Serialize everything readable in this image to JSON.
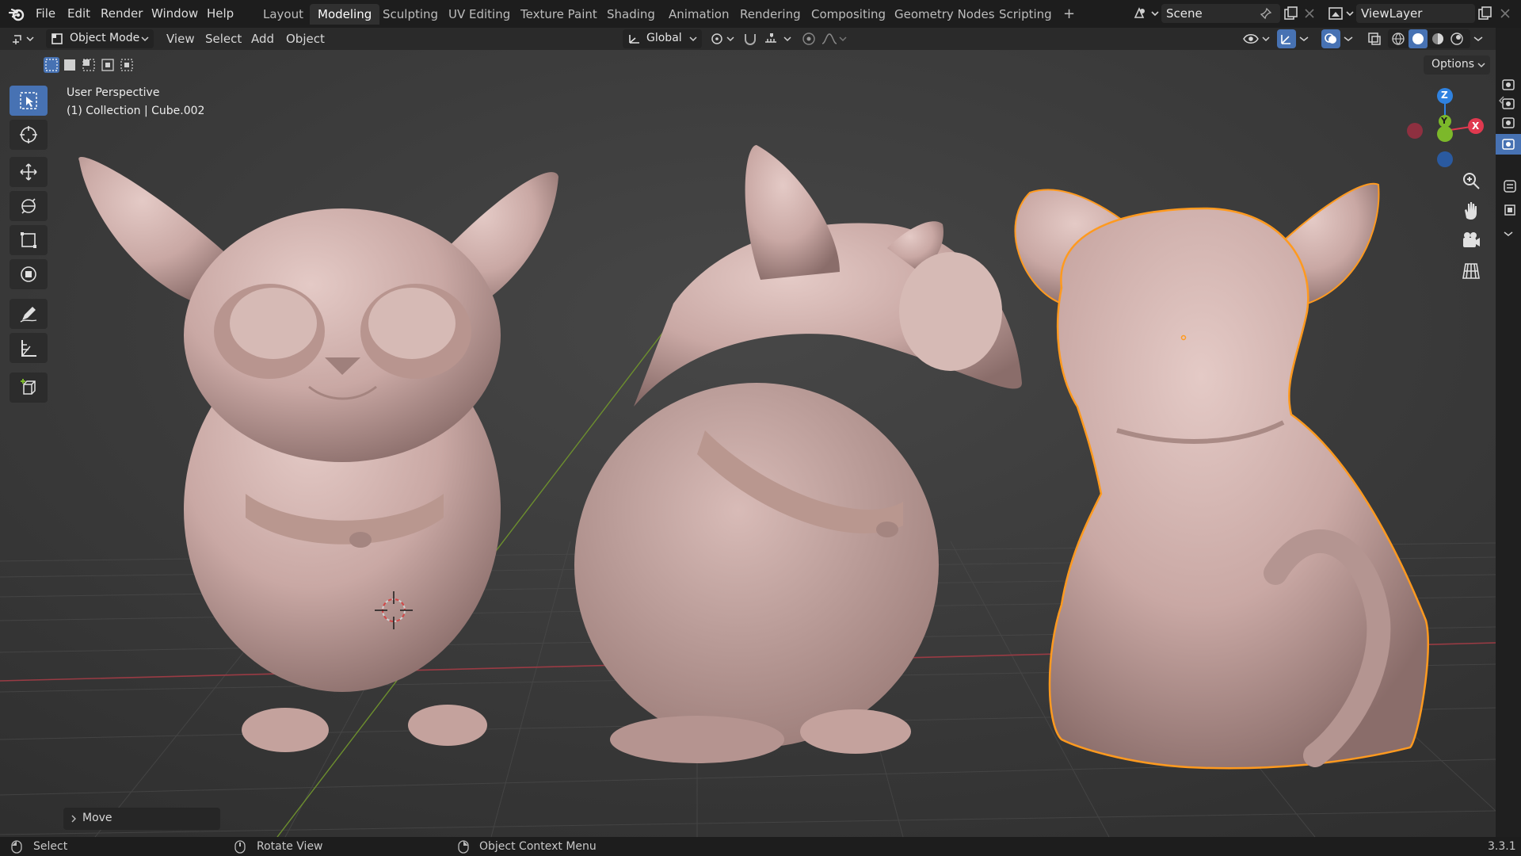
{
  "topbar": {
    "menus": [
      "File",
      "Edit",
      "Render",
      "Window",
      "Help"
    ],
    "workspaces": [
      "Layout",
      "Modeling",
      "Sculpting",
      "UV Editing",
      "Texture Paint",
      "Shading",
      "Animation",
      "Rendering",
      "Compositing",
      "Geometry Nodes",
      "Scripting"
    ],
    "active_workspace": "Modeling",
    "add_workspace": "+",
    "scene_name": "Scene",
    "view_layer": "ViewLayer"
  },
  "header": {
    "mode": "Object Mode",
    "menus": [
      "View",
      "Select",
      "Add",
      "Object"
    ],
    "transform_orientation": "Global"
  },
  "viewport": {
    "perspective_label": "User Perspective",
    "collection_label": "(1) Collection | Cube.002",
    "options_label": "Options",
    "gizmo": {
      "z": "Z",
      "y": "Y",
      "x": "X"
    },
    "last_operation": "Move"
  },
  "statusbar": {
    "items": [
      "Select",
      "Rotate View",
      "Object Context Menu"
    ],
    "version": "3.3.1"
  },
  "colors": {
    "accent": "#4772b3",
    "selection_outline": "#ff9a1f",
    "x_axis": "#e0394f",
    "y_axis": "#7cb82a",
    "z_axis": "#2f82e0",
    "sculpt_clay": "#c9a8a4"
  }
}
